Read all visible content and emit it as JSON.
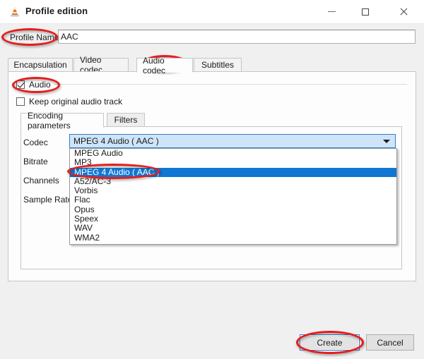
{
  "window": {
    "title": "Profile edition",
    "icon": "vlc-cone-icon",
    "controls": {
      "minimize": "minimize-icon",
      "maximize": "maximize-icon",
      "close": "close-icon"
    }
  },
  "profile_name": {
    "label": "Profile Name",
    "value": "AAC",
    "placeholder": ""
  },
  "tabs": [
    {
      "label": "Encapsulation",
      "selected": false
    },
    {
      "label": "Video codec",
      "selected": false
    },
    {
      "label": "Audio codec",
      "selected": true
    },
    {
      "label": "Subtitles",
      "selected": false
    }
  ],
  "checkboxes": [
    {
      "label": "Audio",
      "checked": true
    },
    {
      "label": "Keep original audio track",
      "checked": false
    }
  ],
  "inner_tabs": [
    {
      "label": "Encoding parameters",
      "selected": true
    },
    {
      "label": "Filters",
      "selected": false
    }
  ],
  "form": {
    "labels": {
      "codec": "Codec",
      "bitrate": "Bitrate",
      "channels": "Channels",
      "sample_rate": "Sample Rate"
    },
    "codec_combo": {
      "value": "MPEG 4 Audio ( AAC )",
      "expanded": true,
      "arrow_icon": "chevron-down-icon",
      "options": [
        "MPEG Audio",
        "MP3",
        "MPEG 4 Audio ( AAC )",
        "A52/AC-3",
        "Vorbis",
        "Flac",
        "Opus",
        "Speex",
        "WAV",
        "WMA2"
      ],
      "selected_index": 2
    }
  },
  "buttons": {
    "create": "Create",
    "cancel": "Cancel"
  },
  "annotations": {
    "color": "#e81b1b",
    "targets": [
      "Profile Name",
      "Audio codec",
      "Audio",
      "MPEG 4 Audio ( AAC )",
      "Create"
    ]
  },
  "colors": {
    "selection_blue": "#1277d2",
    "combo_fill": "#cfe4f7",
    "combo_border": "#2f7fd0",
    "window_bg": "#f0f0f0",
    "panel_bg": "#fdfdfd",
    "annotation_red": "#e81b1b"
  }
}
